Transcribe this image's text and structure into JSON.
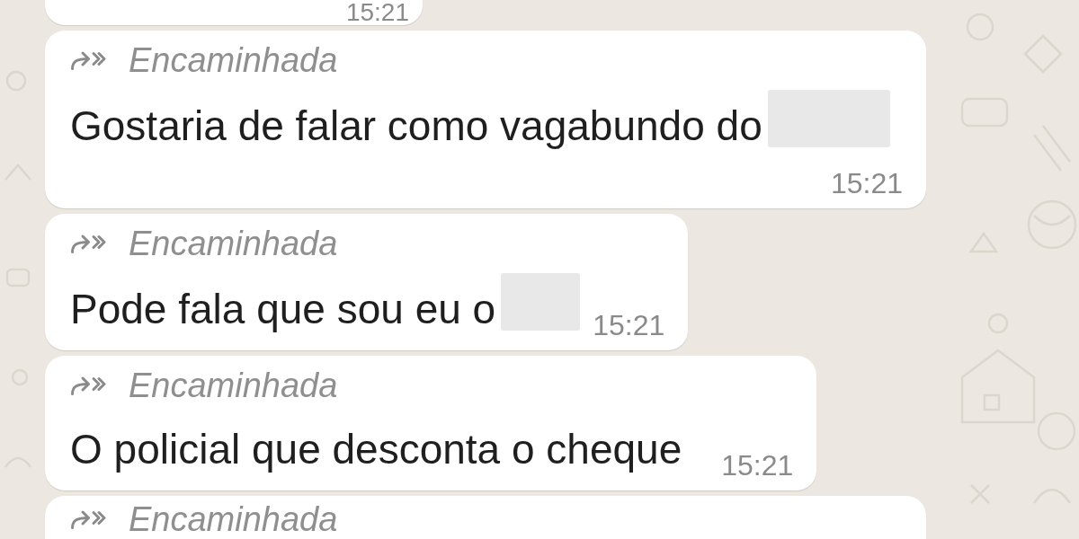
{
  "chat": {
    "messages": [
      {
        "kind": "time-only",
        "time": "15:21"
      },
      {
        "kind": "forwarded",
        "forwarded_label": "Encaminhada",
        "text": "Gostaria de falar como vagabundo do",
        "redacted": true,
        "time": "15:21"
      },
      {
        "kind": "forwarded",
        "forwarded_label": "Encaminhada",
        "text": "Pode fala que sou eu o",
        "redacted": true,
        "time": "15:21"
      },
      {
        "kind": "forwarded",
        "forwarded_label": "Encaminhada",
        "text": "O policial que desconta o cheque",
        "redacted": false,
        "time": "15:21"
      },
      {
        "kind": "header-only",
        "forwarded_label": "Encaminhada"
      }
    ]
  }
}
